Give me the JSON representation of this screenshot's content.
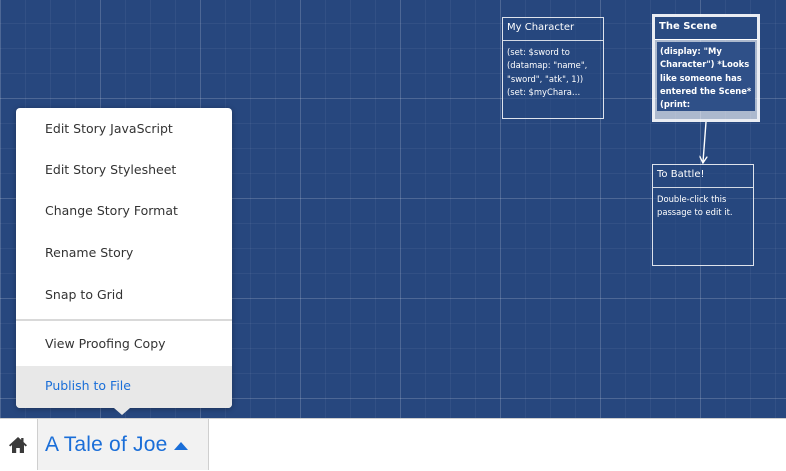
{
  "passages": [
    {
      "title": "My Character",
      "excerpt": "(set: $sword to (datamap: \"name\", \"sword\", \"atk\", 1)) (set: $myChara…",
      "selected": false
    },
    {
      "title": "The Scene",
      "excerpt": "(display: \"My Character\") *Looks like someone has entered the Scene* (print: $myCharact…",
      "selected": true
    },
    {
      "title": "To Battle!",
      "excerpt": "Double-click this passage to edit it.",
      "selected": false
    }
  ],
  "menu": {
    "items": [
      {
        "label": "Edit Story JavaScript"
      },
      {
        "label": "Edit Story Stylesheet"
      },
      {
        "label": "Change Story Format"
      },
      {
        "label": "Rename Story"
      },
      {
        "label": "Snap to Grid"
      },
      {
        "label": "View Proofing Copy"
      },
      {
        "label": "Publish to File"
      }
    ]
  },
  "toolbar": {
    "home_icon": "home-icon",
    "story_title": "A Tale of Joe",
    "caret_icon": "caret-up-icon"
  },
  "colors": {
    "background": "#27477e",
    "accent": "#1a6ed8",
    "menu_highlight": "#e8e8e8"
  }
}
